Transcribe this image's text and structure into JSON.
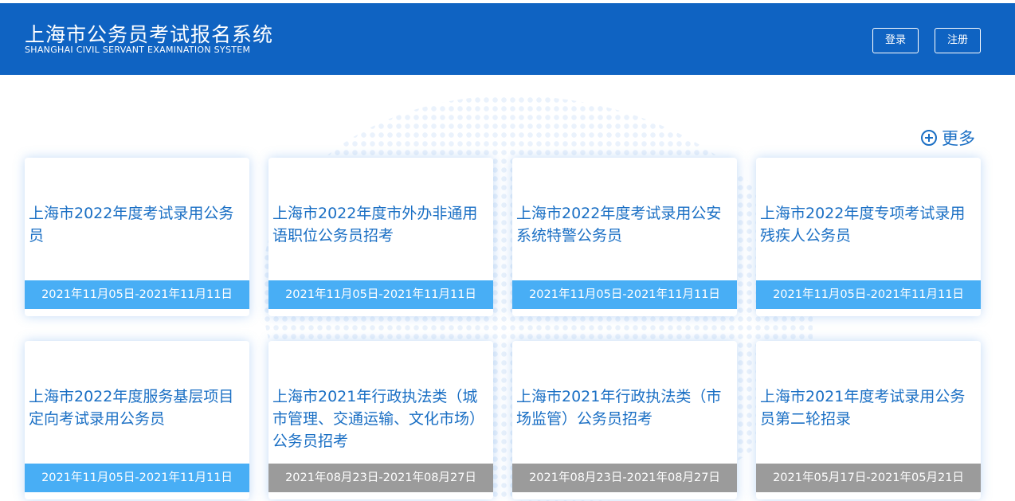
{
  "header": {
    "title": "上海市公务员考试报名系统",
    "subtitle": "SHANGHAI CIVIL SERVANT EXAMINATION SYSTEM",
    "login_label": "登录",
    "register_label": "注册",
    "bg_color": "#0f63c2"
  },
  "more": {
    "label": "更多",
    "icon": "plus-circle-icon"
  },
  "cards": [
    {
      "title": "上海市2022年度考试录用公务员",
      "date": "2021年11月05日-2021年11月11日",
      "status": "active"
    },
    {
      "title": "上海市2022年度市外办非通用语职位公务员招考",
      "date": "2021年11月05日-2021年11月11日",
      "status": "active"
    },
    {
      "title": "上海市2022年度考试录用公安系统特警公务员",
      "date": "2021年11月05日-2021年11月11日",
      "status": "active"
    },
    {
      "title": "上海市2022年度专项考试录用残疾人公务员",
      "date": "2021年11月05日-2021年11月11日",
      "status": "active"
    },
    {
      "title": "上海市2022年度服务基层项目定向考试录用公务员",
      "date": "2021年11月05日-2021年11月11日",
      "status": "active"
    },
    {
      "title": "上海市2021年行政执法类（城市管理、交通运输、文化市场）公务员招考",
      "date": "2021年08月23日-2021年08月27日",
      "status": "closed"
    },
    {
      "title": "上海市2021年行政执法类（市场监管）公务员招考",
      "date": "2021年08月23日-2021年08月27日",
      "status": "closed"
    },
    {
      "title": "上海市2021年度考试录用公务员第二轮招录",
      "date": "2021年05月17日-2021年05月21日",
      "status": "closed"
    }
  ],
  "colors": {
    "accent": "#1a6fc4",
    "date_active": "#48aef5",
    "date_closed": "#9b9b9b"
  }
}
